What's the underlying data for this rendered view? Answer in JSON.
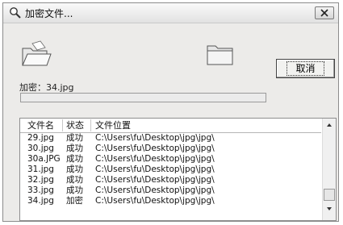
{
  "window": {
    "title": "加密文件...",
    "close_glyph": "×"
  },
  "cancel_label": "取消",
  "status_text": "加密：34.jpg",
  "progress": 0,
  "list": {
    "columns": [
      "文件名",
      "状态",
      "文件位置"
    ],
    "rows": [
      {
        "name": "29.jpg",
        "status": "成功",
        "path": "C:\\Users\\fu\\Desktop\\jpg\\jpg\\"
      },
      {
        "name": "30.jpg",
        "status": "成功",
        "path": "C:\\Users\\fu\\Desktop\\jpg\\jpg\\"
      },
      {
        "name": "30a.JPG",
        "status": "成功",
        "path": "C:\\Users\\fu\\Desktop\\jpg\\jpg\\"
      },
      {
        "name": "31.jpg",
        "status": "成功",
        "path": "C:\\Users\\fu\\Desktop\\jpg\\jpg\\"
      },
      {
        "name": "32.jpg",
        "status": "成功",
        "path": "C:\\Users\\fu\\Desktop\\jpg\\jpg\\"
      },
      {
        "name": "33.jpg",
        "status": "成功",
        "path": "C:\\Users\\fu\\Desktop\\jpg\\jpg\\"
      },
      {
        "name": "34.jpg",
        "status": "加密",
        "path": "C:\\Users\\fu\\Desktop\\jpg\\jpg\\"
      }
    ]
  },
  "icons": {
    "title": "magnifier-icon",
    "source_folder": "open-folder-icon",
    "dest_folder": "closed-folder-icon"
  }
}
